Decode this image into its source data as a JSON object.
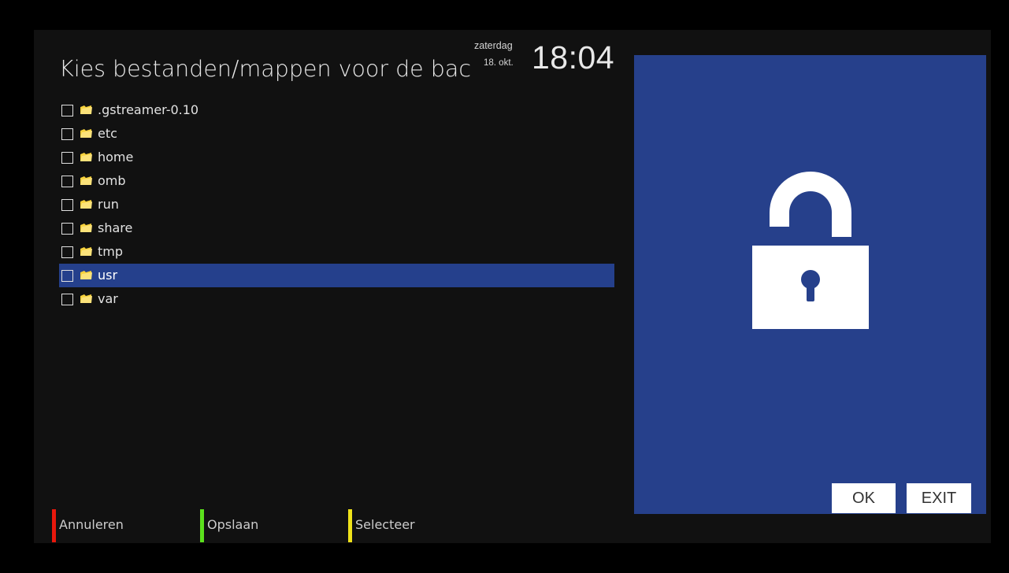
{
  "header": {
    "title": "Kies bestanden/mappen voor de back-up",
    "day": "zaterdag",
    "date": "18. okt.",
    "time": "18:04"
  },
  "file_list": {
    "items": [
      {
        "name": ".gstreamer-0.10",
        "checked": false,
        "selected": false
      },
      {
        "name": "etc",
        "checked": false,
        "selected": false
      },
      {
        "name": "home",
        "checked": false,
        "selected": false
      },
      {
        "name": "omb",
        "checked": false,
        "selected": false
      },
      {
        "name": "run",
        "checked": false,
        "selected": false
      },
      {
        "name": "share",
        "checked": false,
        "selected": false
      },
      {
        "name": "tmp",
        "checked": false,
        "selected": false
      },
      {
        "name": "usr",
        "checked": false,
        "selected": true
      },
      {
        "name": "var",
        "checked": false,
        "selected": false
      }
    ]
  },
  "preview": {
    "icon": "lock-icon",
    "ok_label": "OK",
    "exit_label": "EXIT"
  },
  "color_keys": {
    "red": {
      "label": "Annuleren",
      "color": "#e8180c"
    },
    "green": {
      "label": "Opslaan",
      "color": "#5be01c"
    },
    "yellow": {
      "label": "Selecteer",
      "color": "#efe21a"
    }
  },
  "colors": {
    "accent": "#26408b",
    "selection": "#25408c",
    "folder": "#f7d23c"
  }
}
